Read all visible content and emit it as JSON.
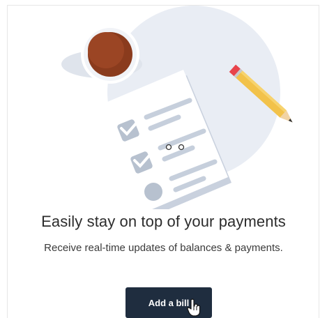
{
  "promo": {
    "headline": "Easily stay on top of your payments",
    "subline": "Receive real-time updates of balances & payments.",
    "button_label": "Add a bill"
  },
  "icons": {
    "illustration": "bill-checklist-illustration",
    "cursor": "hand-pointer-icon"
  },
  "colors": {
    "button_bg": "#1f2d3f",
    "button_text": "#ffffff",
    "circle_bg": "#e8ecf3",
    "pencil": "#f2c24a",
    "coffee": "#8a3b1d"
  }
}
